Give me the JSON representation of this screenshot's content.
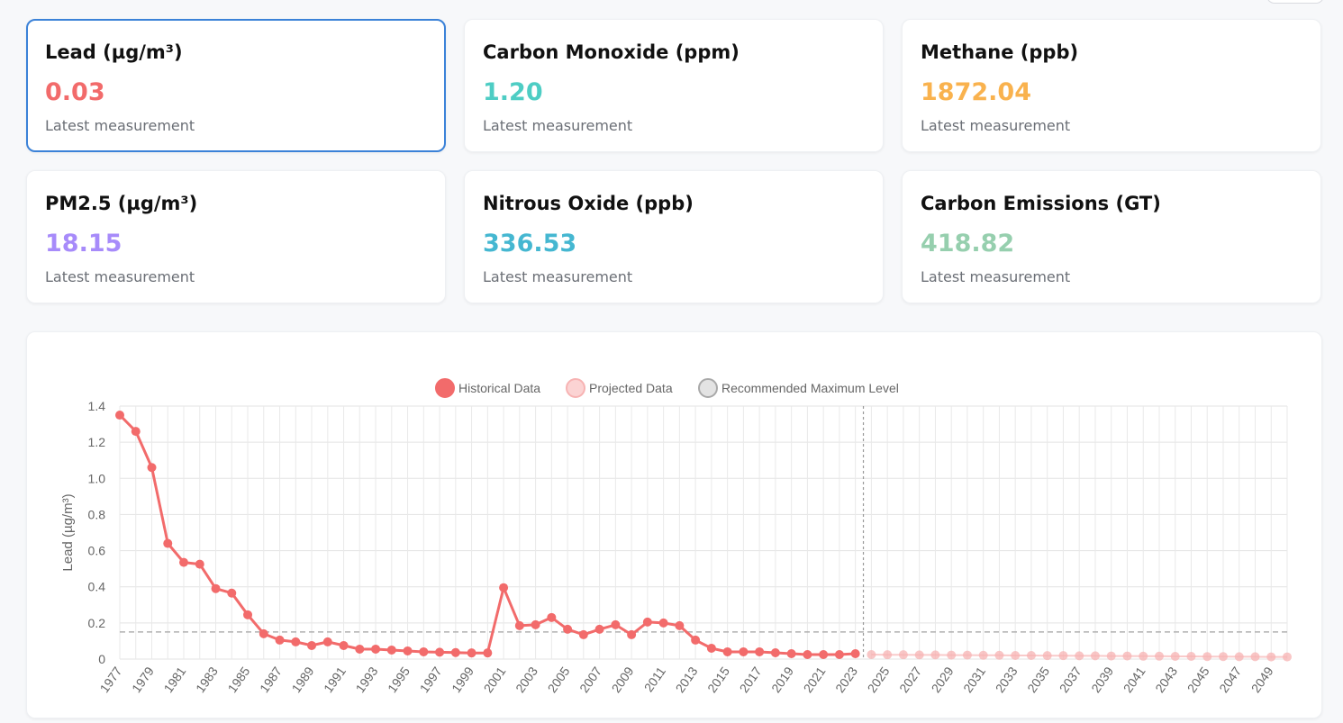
{
  "cards": [
    {
      "title": "Lead (µg/m³)",
      "value": "0.03",
      "sub": "Latest measurement",
      "color": "#f26b6b",
      "selected": true
    },
    {
      "title": "Carbon Monoxide (ppm)",
      "value": "1.20",
      "sub": "Latest measurement",
      "color": "#4ecdc4",
      "selected": false
    },
    {
      "title": "Methane (ppb)",
      "value": "1872.04",
      "sub": "Latest measurement",
      "color": "#f9b24e",
      "selected": false
    },
    {
      "title": "PM2.5 (µg/m³)",
      "value": "18.15",
      "sub": "Latest measurement",
      "color": "#a78bfa",
      "selected": false
    },
    {
      "title": "Nitrous Oxide (ppb)",
      "value": "336.53",
      "sub": "Latest measurement",
      "color": "#45b7d1",
      "selected": false
    },
    {
      "title": "Carbon Emissions (GT)",
      "value": "418.82",
      "sub": "Latest measurement",
      "color": "#96cfae",
      "selected": false
    }
  ],
  "chart_data": {
    "type": "line",
    "ylabel": "Lead (µg/m³)",
    "ylim": [
      0,
      1.4
    ],
    "yticks": [
      "0",
      "0.2",
      "0.4",
      "0.6",
      "0.8",
      "1.0",
      "1.2",
      "1.4"
    ],
    "xlim": [
      1977,
      2050
    ],
    "grid": true,
    "legend_position": "top",
    "legend": [
      "Historical Data",
      "Projected Data",
      "Recommended Maximum Level"
    ],
    "recommended_max": 0.15,
    "divider_year": 2023.5,
    "colors": {
      "historical": "#f26b6b",
      "projected": "#f7b3b3",
      "reference": "#b0b0b0"
    },
    "series": [
      {
        "name": "Historical Data",
        "x": [
          1977,
          1978,
          1979,
          1980,
          1981,
          1982,
          1983,
          1984,
          1985,
          1986,
          1987,
          1988,
          1989,
          1990,
          1991,
          1992,
          1993,
          1994,
          1995,
          1996,
          1997,
          1998,
          1999,
          2000,
          2001,
          2002,
          2003,
          2004,
          2005,
          2006,
          2007,
          2008,
          2009,
          2010,
          2011,
          2012,
          2013,
          2014,
          2015,
          2016,
          2017,
          2018,
          2019,
          2020,
          2021,
          2022,
          2023
        ],
        "values": [
          1.35,
          1.26,
          1.06,
          0.64,
          0.535,
          0.525,
          0.39,
          0.365,
          0.245,
          0.14,
          0.105,
          0.095,
          0.075,
          0.095,
          0.075,
          0.055,
          0.055,
          0.05,
          0.045,
          0.04,
          0.038,
          0.036,
          0.034,
          0.034,
          0.395,
          0.185,
          0.19,
          0.23,
          0.165,
          0.135,
          0.165,
          0.19,
          0.135,
          0.205,
          0.2,
          0.185,
          0.105,
          0.06,
          0.04,
          0.04,
          0.04,
          0.035,
          0.03,
          0.025,
          0.025,
          0.025,
          0.03
        ]
      },
      {
        "name": "Projected Data",
        "x": [
          2024,
          2025,
          2026,
          2027,
          2028,
          2029,
          2030,
          2031,
          2032,
          2033,
          2034,
          2035,
          2036,
          2037,
          2038,
          2039,
          2040,
          2041,
          2042,
          2043,
          2044,
          2045,
          2046,
          2047,
          2048,
          2049,
          2050
        ],
        "values": [
          0.025,
          0.024,
          0.024,
          0.023,
          0.023,
          0.022,
          0.022,
          0.021,
          0.021,
          0.02,
          0.02,
          0.019,
          0.019,
          0.018,
          0.018,
          0.017,
          0.017,
          0.016,
          0.016,
          0.015,
          0.015,
          0.014,
          0.014,
          0.013,
          0.013,
          0.012,
          0.012
        ]
      }
    ]
  }
}
